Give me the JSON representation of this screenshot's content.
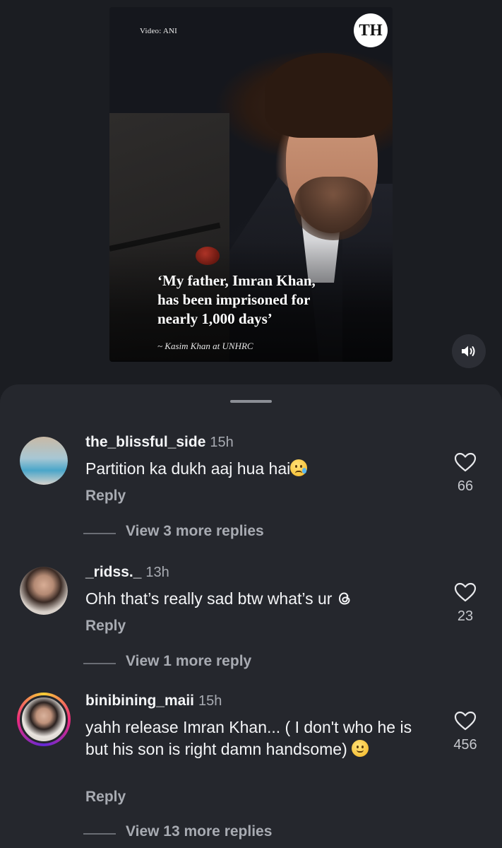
{
  "video": {
    "credit": "Video: ANI",
    "logo_text": "TH",
    "quote_lines": [
      "‘My father, Imran Khan,",
      "has been imprisoned for",
      "nearly 1,000 days’"
    ],
    "attribution": "~ Kasim Khan at UNHRC"
  },
  "comments": [
    {
      "username": "the_blissful_side",
      "time": "15h",
      "text": "Partition ka dukh aaj hua hai",
      "emoji": "sad-tear-face",
      "reply_label": "Reply",
      "likes": "66",
      "view_replies": "View 3 more replies"
    },
    {
      "username": "_ridss._",
      "time": "13h",
      "text": "Ohh that’s really sad btw what’s ur",
      "emoji": "threads-icon",
      "reply_label": "Reply",
      "likes": "23",
      "view_replies": "View 1 more reply"
    },
    {
      "username": "binibining_maii",
      "time": "15h",
      "text": "yahh release Imran Khan... ( I don't who he is but his son is right damn handsome)",
      "emoji": "slight-smile-face",
      "reply_label": "Reply",
      "likes": "456",
      "view_replies": "View 13 more replies"
    }
  ],
  "colors": {
    "background": "#1b1d22",
    "sheet": "#25272d",
    "text_primary": "#f4f5f7",
    "text_secondary": "#a8abb2"
  }
}
